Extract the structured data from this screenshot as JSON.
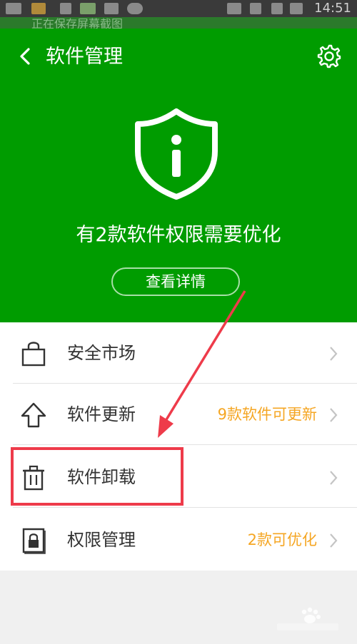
{
  "status_bar": {
    "time": "14:51"
  },
  "notification": {
    "text": "正在保存屏幕截图"
  },
  "header": {
    "title": "软件管理",
    "headline": "有2款软件权限需要优化",
    "detail_button": "查看详情"
  },
  "list": {
    "items": [
      {
        "label": "安全市场",
        "info": "",
        "icon": "bag-icon"
      },
      {
        "label": "软件更新",
        "info": "9款软件可更新",
        "icon": "upload-arrow-icon"
      },
      {
        "label": "软件卸载",
        "info": "",
        "icon": "trash-icon"
      },
      {
        "label": "权限管理",
        "info": "2款可优化",
        "icon": "lock-icon"
      }
    ]
  },
  "colors": {
    "header_green": "#009c00",
    "info_orange": "#f5a623",
    "annotation_red": "#ee3b4a"
  }
}
